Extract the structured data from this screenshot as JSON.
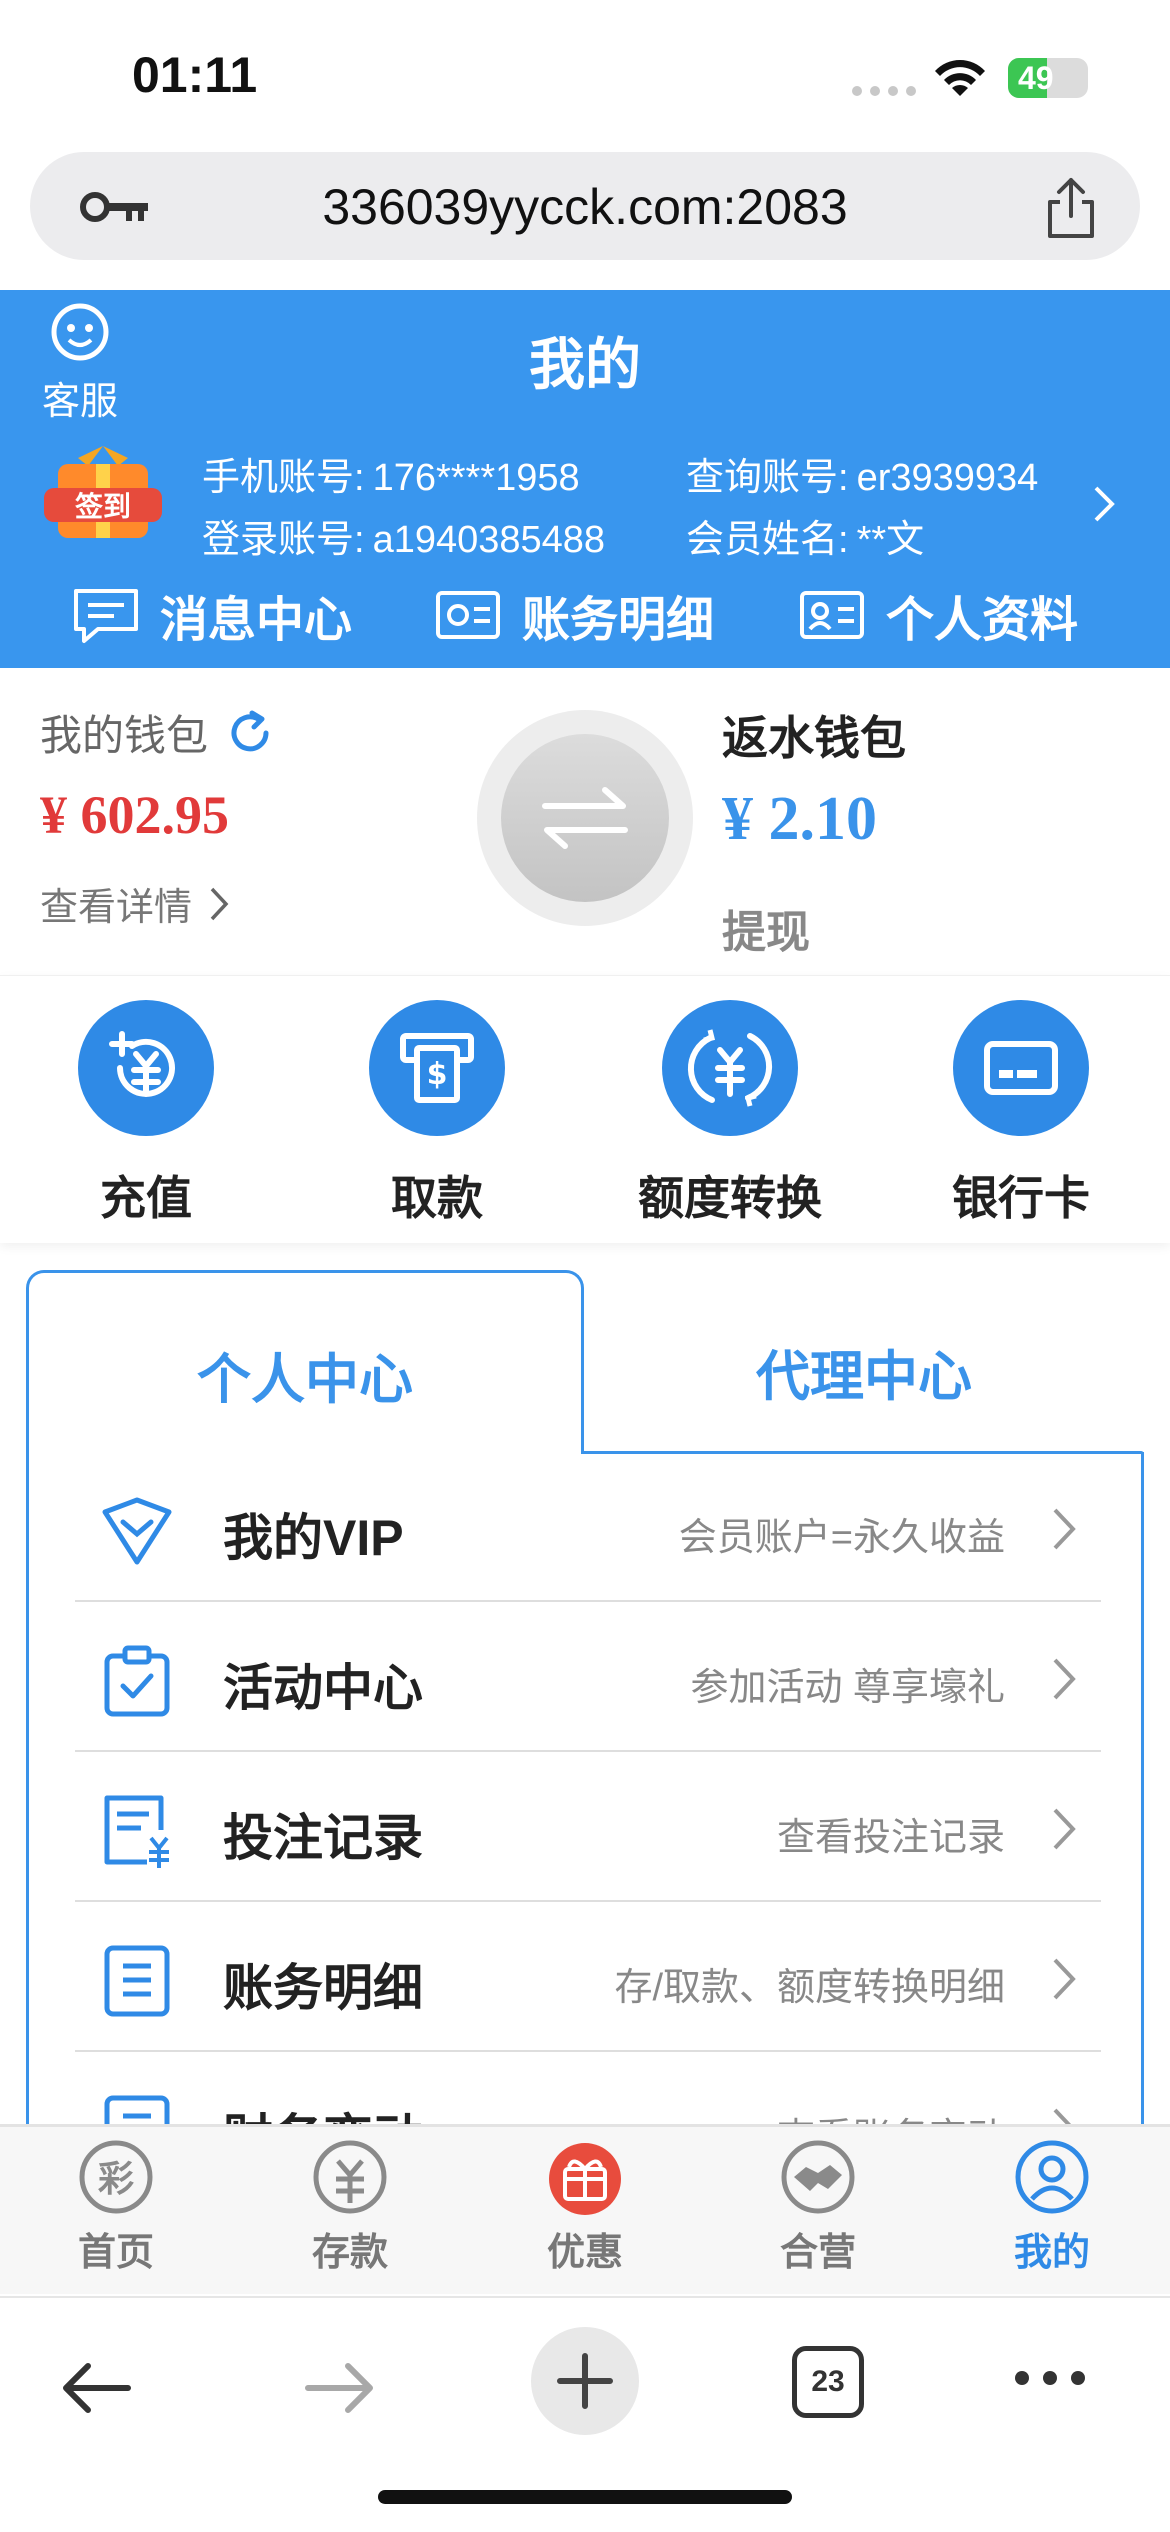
{
  "status_bar": {
    "time": "01:11",
    "battery": "49",
    "battery_level": 0.49
  },
  "browser": {
    "url": "336039yycck.com:2083",
    "tab_count": "23"
  },
  "header": {
    "customer_service": "客服",
    "title": "我的",
    "signin_badge": "签到",
    "phone_label": "手机账号:",
    "phone_value": "176****1958",
    "query_label": "查询账号:",
    "query_value": "er3939934",
    "login_label": "登录账号:",
    "login_value": "a1940385488",
    "name_label": "会员姓名:",
    "name_value": "**文",
    "quick_nav": [
      "消息中心",
      "账务明细",
      "个人资料"
    ]
  },
  "wallet": {
    "my_wallet_label": "我的钱包",
    "my_wallet_amount": "¥ 602.95",
    "view_details": "查看详情",
    "rebate_label": "返水钱包",
    "rebate_amount": "¥ 2.10",
    "withdraw": "提现"
  },
  "actions": [
    "充值",
    "取款",
    "额度转换",
    "银行卡"
  ],
  "tabs": {
    "personal": "个人中心",
    "agent": "代理中心"
  },
  "menu": [
    {
      "title": "我的VIP",
      "desc": "会员账户=永久收益",
      "icon": "vip-icon"
    },
    {
      "title": "活动中心",
      "desc": "参加活动 尊享壕礼",
      "icon": "clipboard-icon"
    },
    {
      "title": "投注记录",
      "desc": "查看投注记录",
      "icon": "bet-record-icon"
    },
    {
      "title": "账务明细",
      "desc": "存/取款、额度转换明细",
      "icon": "document-icon"
    },
    {
      "title": "财务变动",
      "desc": "查看账务变动",
      "icon": "finance-icon"
    }
  ],
  "bottom_tabs": [
    "首页",
    "存款",
    "优惠",
    "合营",
    "我的"
  ],
  "colors": {
    "header_blue": "#3996ee",
    "accent_blue": "#2f8ae6",
    "amount_red": "#e13a3a"
  }
}
